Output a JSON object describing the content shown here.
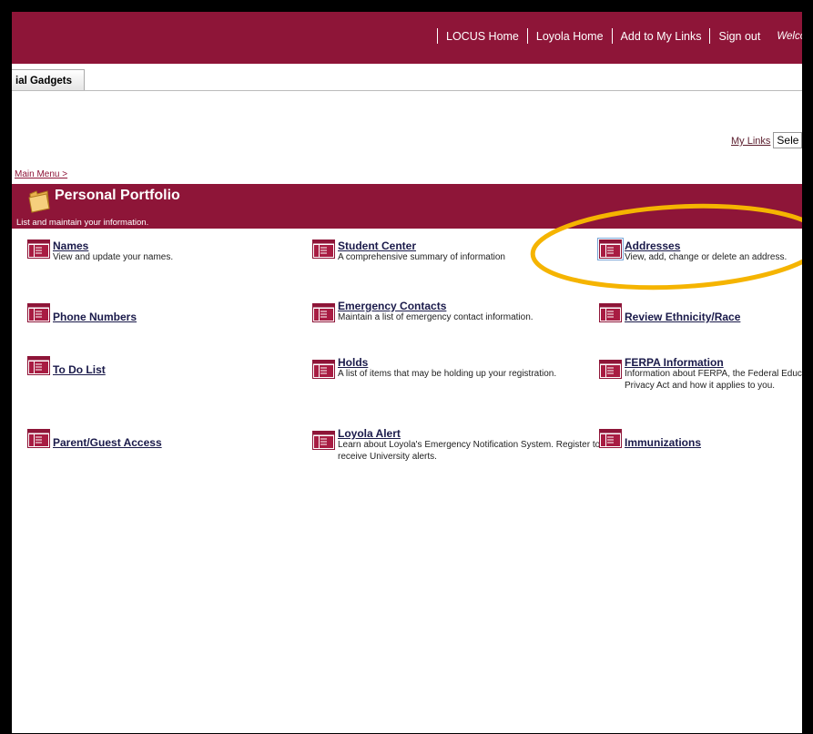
{
  "header": {
    "nav": [
      "LOCUS Home",
      "Loyola Home",
      "Add to My Links",
      "Sign out"
    ],
    "welcome": "Welcome S"
  },
  "tabs": {
    "active": "ial Gadgets"
  },
  "my_links": {
    "label": "My Links",
    "select_value": "Sele"
  },
  "breadcrumb": {
    "main_menu": "Main Menu >"
  },
  "portfolio": {
    "title": "Personal Portfolio",
    "description": "List and maintain your information."
  },
  "items": {
    "names": {
      "title": "Names",
      "desc": "View and update your names."
    },
    "student_center": {
      "title": "Student Center",
      "desc": "A comprehensive summary of information"
    },
    "addresses": {
      "title": "Addresses",
      "desc": "View, add, change or delete an address."
    },
    "phone_numbers": {
      "title": "Phone Numbers"
    },
    "emergency_contacts": {
      "title": "Emergency Contacts",
      "desc": "Maintain a list of emergency contact information."
    },
    "ethnicity": {
      "title": "Review Ethnicity/Race"
    },
    "todo": {
      "title": "To Do List"
    },
    "holds": {
      "title": "Holds",
      "desc": "A list of items that may be holding up your registration."
    },
    "ferpa": {
      "title": "FERPA Information",
      "desc1": "Information about FERPA, the Federal Educat",
      "desc2": "Privacy Act and how it applies to you."
    },
    "parent_guest": {
      "title": "Parent/Guest Access"
    },
    "loyola_alert": {
      "title": "Loyola Alert",
      "desc1": "Learn about Loyola's Emergency Notification System. Register to",
      "desc2": "receive University alerts."
    },
    "immunizations": {
      "title": "Immunizations"
    }
  },
  "colors": {
    "brand": "#8e1538",
    "highlight": "#f5b400"
  },
  "icons": {
    "page": "page-list-icon",
    "folder": "folder-icon"
  }
}
